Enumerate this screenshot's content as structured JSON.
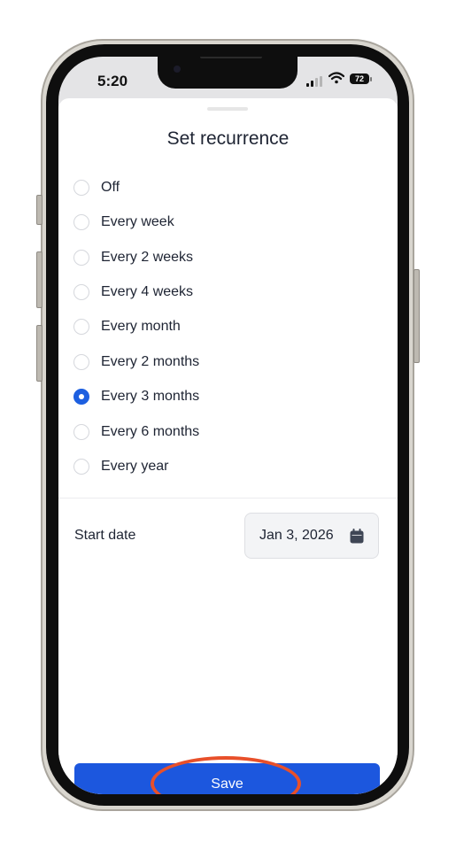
{
  "status_bar": {
    "time": "5:20",
    "battery": "72"
  },
  "sheet": {
    "title": "Set recurrence"
  },
  "options": [
    {
      "label": "Off",
      "checked": false
    },
    {
      "label": "Every week",
      "checked": false
    },
    {
      "label": "Every 2 weeks",
      "checked": false
    },
    {
      "label": "Every 4 weeks",
      "checked": false
    },
    {
      "label": "Every month",
      "checked": false
    },
    {
      "label": "Every 2 months",
      "checked": false
    },
    {
      "label": "Every 3 months",
      "checked": true
    },
    {
      "label": "Every 6 months",
      "checked": false
    },
    {
      "label": "Every year",
      "checked": false
    }
  ],
  "start_date": {
    "label": "Start date",
    "value": "Jan 3, 2026"
  },
  "save": {
    "label": "Save"
  },
  "colors": {
    "accent": "#1c57de",
    "highlight_ring": "#e8502a",
    "text": "#1e2433"
  }
}
